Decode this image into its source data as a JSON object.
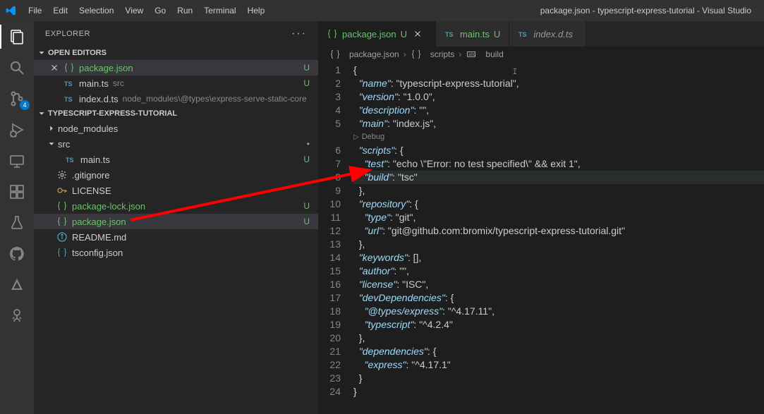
{
  "titlebar": {
    "menu": [
      "File",
      "Edit",
      "Selection",
      "View",
      "Go",
      "Run",
      "Terminal",
      "Help"
    ],
    "title": "package.json - typescript-express-tutorial - Visual Studio"
  },
  "activity": {
    "scm_badge": "4"
  },
  "sidebar": {
    "title": "EXPLORER",
    "sections": {
      "open_editors": "Open Editors",
      "project": "typescript-express-tutorial"
    },
    "open_editors": [
      {
        "name": "package.json",
        "status": "U",
        "color": "green",
        "icon": "braces-icon",
        "active": true
      },
      {
        "name": "main.ts",
        "hint": "src",
        "status": "U",
        "color": "blue",
        "icon": "ts-icon"
      },
      {
        "name": "index.d.ts",
        "hint": "node_modules\\@types\\express-serve-static-core",
        "color": "blue",
        "icon": "ts-icon"
      }
    ],
    "tree": [
      {
        "type": "folder",
        "name": "node_modules",
        "open": false,
        "indent": 0
      },
      {
        "type": "folder",
        "name": "src",
        "open": true,
        "git": "dot",
        "indent": 0
      },
      {
        "type": "file",
        "name": "main.ts",
        "status": "U",
        "icon": "ts-icon",
        "color": "blue",
        "indent": 1
      },
      {
        "type": "file",
        "name": ".gitignore",
        "icon": "gear-icon",
        "color": "gray",
        "indent": 0
      },
      {
        "type": "file",
        "name": "LICENSE",
        "icon": "key-icon",
        "color": "folder",
        "indent": 0
      },
      {
        "type": "file",
        "name": "package-lock.json",
        "status": "U",
        "icon": "braces-icon",
        "color": "green",
        "indent": 0,
        "textcolor": "green"
      },
      {
        "type": "file",
        "name": "package.json",
        "status": "U",
        "icon": "braces-icon",
        "color": "green",
        "indent": 0,
        "active": true,
        "textcolor": "green"
      },
      {
        "type": "file",
        "name": "README.md",
        "icon": "info-icon",
        "color": "blue",
        "indent": 0
      },
      {
        "type": "file",
        "name": "tsconfig.json",
        "icon": "braces-icon",
        "color": "blue",
        "indent": 0
      }
    ]
  },
  "tabs": [
    {
      "name": "package.json",
      "mod": "U",
      "icon": "braces-icon",
      "color": "green",
      "active": true,
      "closeable": true,
      "textcolor": "green"
    },
    {
      "name": "main.ts",
      "mod": "U",
      "icon": "ts-icon",
      "color": "blue",
      "textcolor": "green"
    },
    {
      "name": "index.d.ts",
      "icon": "ts-icon",
      "color": "blue",
      "italic": true
    }
  ],
  "breadcrumbs": [
    "package.json",
    "scripts",
    "build"
  ],
  "breadcrumb_icons": [
    "braces-icon",
    "braces-icon",
    "text-icon"
  ],
  "debug_lens": "Debug",
  "code_lines": [
    "{",
    "  \"name\": \"typescript-express-tutorial\",",
    "  \"version\": \"1.0.0\",",
    "  \"description\": \"\",",
    "  \"main\": \"index.js\",",
    "  \"scripts\": {",
    "    \"test\": \"echo \\\"Error: no test specified\\\" && exit 1\",",
    "    \"build\": \"tsc\"",
    "  },",
    "  \"repository\": {",
    "    \"type\": \"git\",",
    "    \"url\": \"git@github.com:bromix/typescript-express-tutorial.git\"",
    "  },",
    "  \"keywords\": [],",
    "  \"author\": \"\",",
    "  \"license\": \"ISC\",",
    "  \"devDependencies\": {",
    "    \"@types/express\": \"^4.17.11\",",
    "    \"typescript\": \"^4.2.4\"",
    "  },",
    "  \"dependencies\": {",
    "    \"express\": \"^4.17.1\"",
    "  }",
    "}"
  ],
  "highlight_line": 8,
  "line_count": 24
}
